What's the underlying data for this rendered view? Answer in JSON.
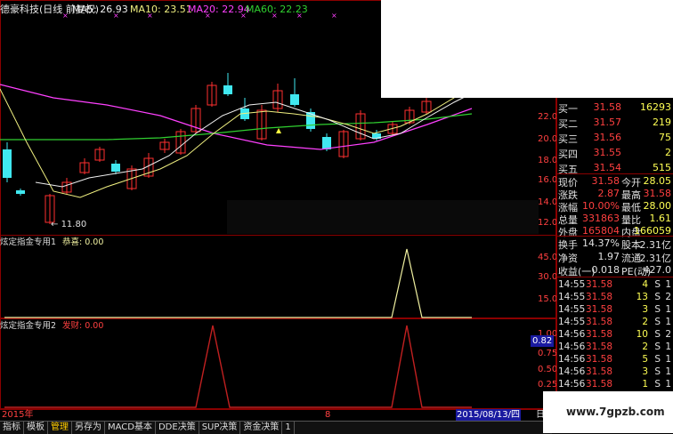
{
  "colors": {
    "up": "#ff3030",
    "down": "#40e8f0",
    "ma5": "#f0f0f0",
    "ma10": "#f0f080",
    "ma20": "#ff40ff",
    "ma60": "#30d030",
    "indicator1": "#f0f0a0",
    "indicator2": "#c02020",
    "grid": "#8b0000"
  },
  "header": {
    "stock_label": "德豪科技(日线 前复权)",
    "ma5": "MA5: 26.93",
    "ma10": "MA10: 23.51",
    "ma20": "MA20: 22.94",
    "ma60": "MA60: 22.23"
  },
  "main_chart": {
    "low_label": "11.80",
    "axis": [
      "22.00",
      "20.00",
      "18.00",
      "16.00",
      "14.00",
      "12.00"
    ]
  },
  "indicator1": {
    "title": "炫定指金专用1",
    "series_label": "恭喜: 0.00",
    "axis": [
      "45.00",
      "30.00",
      "15.00"
    ]
  },
  "indicator2": {
    "title": "炫定指金专用2",
    "series_label": "发财: 0.00",
    "axis": [
      "1.00",
      "0.82",
      "0.75",
      "0.50",
      "0.25"
    ]
  },
  "time_axis": {
    "start": "2015年",
    "mid": "8",
    "cursor_date": "2015/08/13/四",
    "corner": "日"
  },
  "bottom_tabs": [
    "指标",
    "模板",
    "管理",
    "另存为",
    "MACD基本",
    "DDE决策",
    "SUP决策",
    "资金决策",
    "1"
  ],
  "bottom_tabs_active": 2,
  "order_book": [
    {
      "label": "买一",
      "price": "31.58",
      "vol": "16293"
    },
    {
      "label": "买二",
      "price": "31.57",
      "vol": "219"
    },
    {
      "label": "买三",
      "price": "31.56",
      "vol": "75"
    },
    {
      "label": "买四",
      "price": "31.55",
      "vol": "2"
    },
    {
      "label": "买五",
      "price": "31.54",
      "vol": "515"
    }
  ],
  "quote": [
    {
      "l1": "现价",
      "v1": "31.58",
      "l2": "今开",
      "v2": "28.05"
    },
    {
      "l1": "涨跌",
      "v1": "2.87",
      "l2": "最高",
      "v2": "31.58"
    },
    {
      "l1": "涨幅",
      "v1": "10.00%",
      "l2": "最低",
      "v2": "28.00"
    },
    {
      "l1": "总量",
      "v1": "331863",
      "l2": "量比",
      "v2": "1.61"
    },
    {
      "l1": "外盘",
      "v1": "165804",
      "l2": "内盘",
      "v2": "166059"
    }
  ],
  "stats": [
    {
      "l1": "换手",
      "v1": "14.37%",
      "l2": "股本",
      "v2": "2.31亿"
    },
    {
      "l1": "净资",
      "v1": "1.97",
      "l2": "流通",
      "v2": "2.31亿"
    },
    {
      "l1": "收益(一)",
      "v1": "0.018",
      "l2": "PE(动)",
      "v2": "427.0"
    }
  ],
  "ticks": [
    {
      "time": "14:55",
      "price": "31.58",
      "vol": "4",
      "side": "S",
      "n": "1"
    },
    {
      "time": "14:55",
      "price": "31.58",
      "vol": "13",
      "side": "S",
      "n": "2"
    },
    {
      "time": "14:55",
      "price": "31.58",
      "vol": "3",
      "side": "S",
      "n": "1"
    },
    {
      "time": "14:55",
      "price": "31.58",
      "vol": "2",
      "side": "S",
      "n": "1"
    },
    {
      "time": "14:56",
      "price": "31.58",
      "vol": "10",
      "side": "S",
      "n": "2"
    },
    {
      "time": "14:56",
      "price": "31.58",
      "vol": "2",
      "side": "S",
      "n": "1"
    },
    {
      "time": "14:56",
      "price": "31.58",
      "vol": "5",
      "side": "S",
      "n": "1"
    },
    {
      "time": "14:56",
      "price": "31.58",
      "vol": "3",
      "side": "S",
      "n": "1"
    },
    {
      "time": "14:56",
      "price": "31.58",
      "vol": "1",
      "side": "S",
      "n": "1"
    }
  ],
  "watermark": "www.7gpzb.com"
}
